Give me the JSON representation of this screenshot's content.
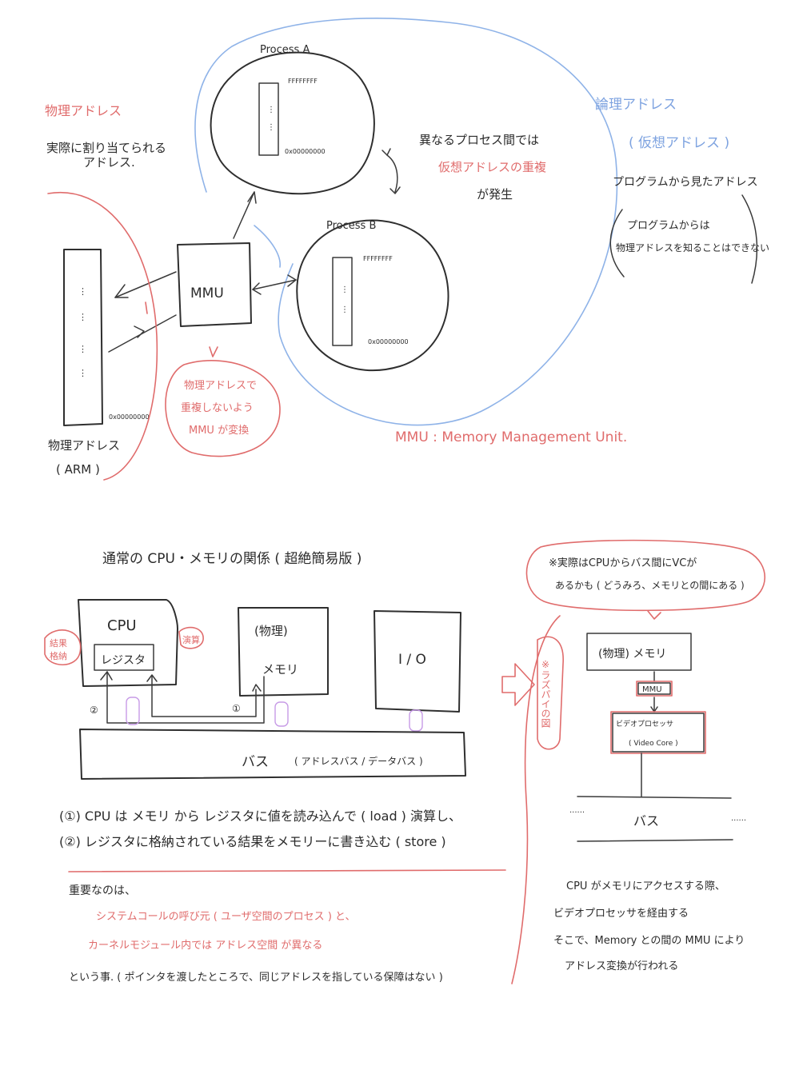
{
  "colors": {
    "ink": "#2f2f2f",
    "red": "#e06c6c",
    "blue": "#8fb3e8",
    "purple": "#c79be6"
  },
  "top": {
    "process_a": {
      "title": "Process A",
      "low_addr": "0x00000000",
      "high_addr": "FFFFFFFF"
    },
    "process_b": {
      "title": "Process B",
      "low_addr": "0x00000000",
      "high_addr": "FFFFFFFF"
    },
    "mmu_label": "MMU",
    "physical_mem": {
      "low_addr": "0x00000000"
    },
    "physical_note_title": "物理アドレス",
    "physical_note_body": [
      "実際に割り当てられる",
      "アドレス."
    ],
    "physical_caption": [
      "物理アドレス",
      "( ARM )"
    ],
    "mmu_note": [
      "物理アドレスで",
      "重複しないよう",
      "MMU が変換"
    ],
    "duplicate_note": [
      "異なるプロセス間では",
      "仮想アドレスの重複",
      "が発生"
    ],
    "logical_title": "論理アドレス",
    "virtual_label": "( 仮想アドレス )",
    "logical_desc": "プログラムから見たアドレス",
    "logical_note": [
      "プログラムからは",
      "物理アドレスを知ることはできない"
    ],
    "mmu_definition": "MMU : Memory Management Unit."
  },
  "bottom": {
    "heading": "通常の CPU・メモリの関係 ( 超絶簡易版 )",
    "cpu_label": "CPU",
    "register_label": "レジスタ",
    "cpu_side_left": [
      "結果",
      "格納"
    ],
    "cpu_side_right": "演算",
    "memory_label": [
      "(物理)",
      "メモリ"
    ],
    "io_label": "I / O",
    "bus_label": "バス",
    "bus_detail": "( アドレスバス / データバス )",
    "marker_1": "①",
    "marker_2": "②",
    "step1": "(①) CPU は メモリ から レジスタに値を読み込んで ( load ) 演算し、",
    "step2": "(②) レジスタに格納されている結果をメモリーに書き込む ( store )",
    "important": [
      "重要なのは、",
      "システムコールの呼び元 ( ユーザ空間のプロセス ) と、",
      "カーネルモジュール内では アドレス空間 が異なる",
      "という事. ( ポインタを渡したところで、同じアドレスを指している保障はない )"
    ]
  },
  "side": {
    "note": [
      "※実際はCPUからバス間にVCが",
      "あるかも ( どうみろ、メモリとの間にある )"
    ],
    "vertical_label": "※ラズパイの図",
    "memory_box": "(物理) メモリ",
    "mmu_box": "MMU",
    "video_box": [
      "ビデオプロセッサ",
      "( Video Core )"
    ],
    "bus_label": "バス",
    "dots": "......",
    "footer": [
      "CPU がメモリにアクセスする際、",
      "ビデオプロセッサを経由する",
      "そこで、Memory との間の MMU により",
      "アドレス変換が行われる"
    ]
  }
}
